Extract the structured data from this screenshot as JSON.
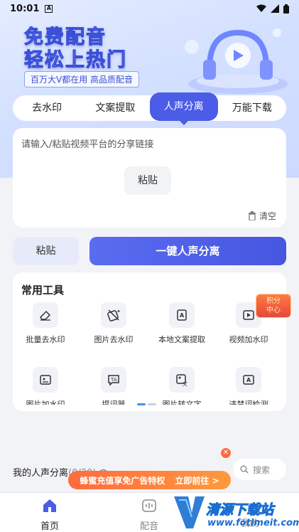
{
  "status_bar": {
    "time": "10:01",
    "notification_icon": "A"
  },
  "banner": {
    "title_line1": "免费配音",
    "title_line2": "轻松上热门",
    "subtitle": "百万大V都在用 高品质配音"
  },
  "tabs": [
    {
      "label": "去水印"
    },
    {
      "label": "文案提取"
    },
    {
      "label": "人声分离",
      "active": true
    },
    {
      "label": "万能下载"
    }
  ],
  "input": {
    "placeholder": "请输入/粘贴视频平台的分享链接",
    "paste_label": "粘贴",
    "clear_label": "清空"
  },
  "actions": {
    "paste_label": "粘贴",
    "main_label": "一键人声分离"
  },
  "tools": {
    "title": "常用工具",
    "items": [
      {
        "label": "批量去水印",
        "icon": "eraser-icon"
      },
      {
        "label": "图片去水印",
        "icon": "image-erase-icon"
      },
      {
        "label": "本地文案提取",
        "icon": "text-extract-icon"
      },
      {
        "label": "视频加水印",
        "icon": "video-watermark-icon"
      },
      {
        "label": "图片加水印",
        "icon": "image-watermark-icon"
      },
      {
        "label": "提词器",
        "icon": "teleprompter-icon"
      },
      {
        "label": "图片转文字",
        "icon": "image-to-text-icon"
      },
      {
        "label": "违禁词检测",
        "icon": "word-check-icon"
      }
    ],
    "points_badge": {
      "line1": "积分",
      "line2": "中心"
    }
  },
  "my_section": {
    "label": "我的人声分离",
    "count": "(0/30)",
    "search_label": "搜索"
  },
  "promo": {
    "text": "蜂蜜充值享免广告特权",
    "cta": "立即前往 >"
  },
  "bottom_nav": [
    {
      "label": "首页",
      "active": true,
      "color": "#4b5de6"
    },
    {
      "label": "配音",
      "active": false,
      "color": "#888888"
    },
    {
      "label": "我的",
      "active": false,
      "color": "#888888"
    }
  ],
  "watermark": {
    "line1": "清源下载站",
    "line2": "www.fotimeit.com"
  }
}
